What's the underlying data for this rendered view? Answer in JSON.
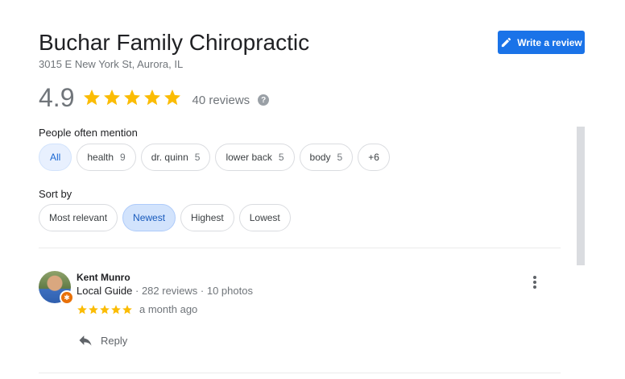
{
  "business": {
    "name": "Buchar Family Chiropractic",
    "address": "3015 E New York St, Aurora, IL"
  },
  "write_review": {
    "label": "Write a review",
    "icon": "pencil-icon",
    "color": "#1a73e8"
  },
  "rating": {
    "value": "4.9",
    "stars": 5,
    "reviews_label": "40 reviews",
    "help_glyph": "?",
    "star_color": "#fbbc04"
  },
  "mentions": {
    "label": "People often mention",
    "chips": [
      {
        "label": "All",
        "count": "",
        "selected": true
      },
      {
        "label": "health",
        "count": "9"
      },
      {
        "label": "dr. quinn",
        "count": "5"
      },
      {
        "label": "lower back",
        "count": "5"
      },
      {
        "label": "body",
        "count": "5"
      },
      {
        "label": "+6",
        "count": ""
      }
    ]
  },
  "sort": {
    "label": "Sort by",
    "options": [
      {
        "label": "Most relevant"
      },
      {
        "label": "Newest",
        "selected": true
      },
      {
        "label": "Highest"
      },
      {
        "label": "Lowest"
      }
    ]
  },
  "review": {
    "reviewer_name": "Kent Munro",
    "reviewer_level": "Local Guide",
    "reviewer_stats": " · 282 reviews · 10 photos",
    "badge_glyph": "✱",
    "stars": 5,
    "date": "a month ago",
    "reply_label": "Reply"
  }
}
